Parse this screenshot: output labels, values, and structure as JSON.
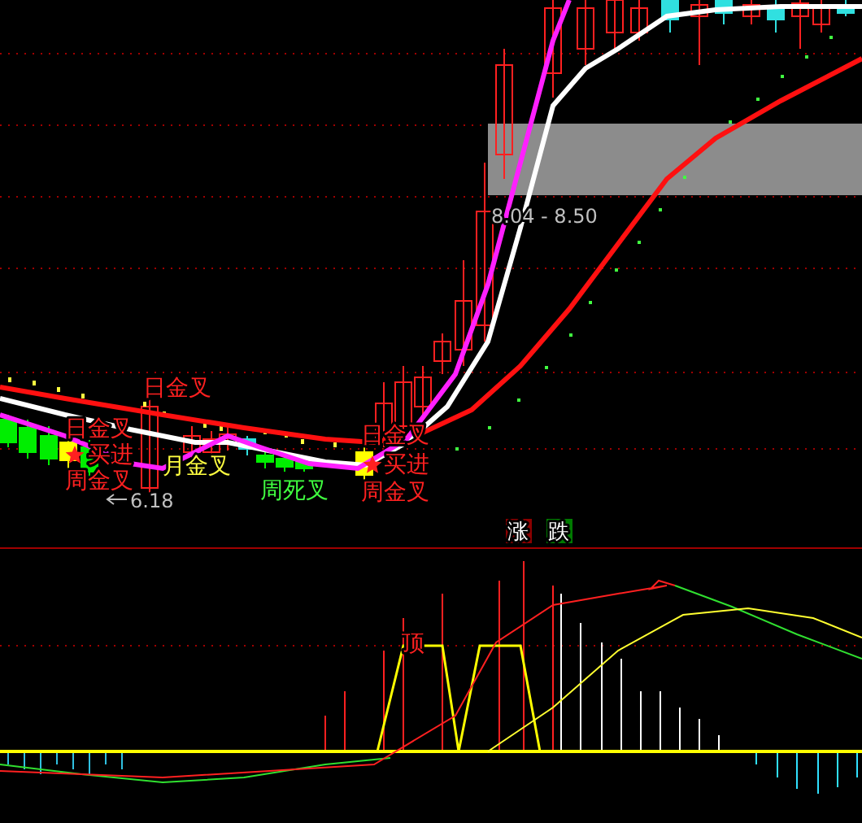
{
  "chart_labels": [
    {
      "text": "日金叉",
      "color": "#ff2020"
    },
    {
      "text": "日金叉",
      "color": "#ff2020"
    },
    {
      "text": "买进",
      "color": "#ff2020"
    },
    {
      "text": "周金叉",
      "color": "#ff2020"
    },
    {
      "text": "月金叉",
      "color": "#ffff40"
    },
    {
      "text": "周死叉",
      "color": "#40ff40"
    },
    {
      "text": "日金叉",
      "color": "#ff2020"
    },
    {
      "text": "买进",
      "color": "#ff2020"
    },
    {
      "text": "周金叉",
      "color": "#ff2020"
    }
  ],
  "low_price": "6.18",
  "price_range": "8.04 - 8.50",
  "buttons": [
    {
      "label": "涨",
      "kind": "rise"
    },
    {
      "label": "跌",
      "kind": "fall"
    }
  ],
  "indicator_label": "顶"
}
